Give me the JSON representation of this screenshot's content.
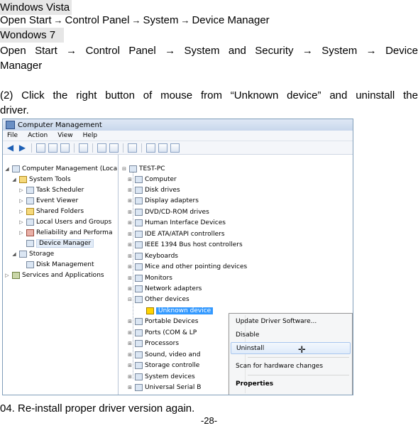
{
  "doc": {
    "vista_heading": "Windows Vista",
    "vista_path": [
      "Open Start",
      "Control Panel",
      "System",
      "Device Manager"
    ],
    "win7_heading": "Wondows 7",
    "win7_path_words": [
      "Open",
      "Start",
      "→",
      "Control",
      "Panel",
      "→",
      "System",
      "and",
      "Security",
      "→",
      "System",
      "→",
      "Device"
    ],
    "win7_path_cont": "Manager",
    "step2_words": [
      "(2)",
      "Click",
      "the",
      "right",
      "button",
      "of",
      "mouse",
      "from",
      "“Unknown",
      "device”",
      "and",
      "uninstall",
      "the"
    ],
    "step2_cont": "driver.",
    "step4": "04. Re-install proper driver version again.",
    "page_number": "-28-",
    "arrow": "→"
  },
  "window": {
    "title": "Computer Management",
    "menu": [
      "File",
      "Action",
      "View",
      "Help"
    ],
    "left_tree": [
      "Computer Management (Local",
      "System Tools",
      "Task Scheduler",
      "Event Viewer",
      "Shared Folders",
      "Local Users and Groups",
      "Reliability and Performa",
      "Device Manager",
      "Storage",
      "Disk Management",
      "Services and Applications"
    ],
    "right_tree": {
      "root": "TEST-PC",
      "items": [
        "Computer",
        "Disk drives",
        "Display adapters",
        "DVD/CD-ROM drives",
        "Human Interface Devices",
        "IDE ATA/ATAPI controllers",
        "IEEE 1394 Bus host controllers",
        "Keyboards",
        "Mice and other pointing devices",
        "Monitors",
        "Network adapters",
        "Other devices",
        "Unknown device",
        "Portable Devices",
        "Ports (COM & LP",
        "Processors",
        "Sound, video and",
        "Storage controlle",
        "System devices",
        "Universal Serial B"
      ]
    },
    "context_menu": [
      "Update Driver Software...",
      "Disable",
      "Uninstall",
      "Scan for hardware changes",
      "Properties"
    ]
  }
}
